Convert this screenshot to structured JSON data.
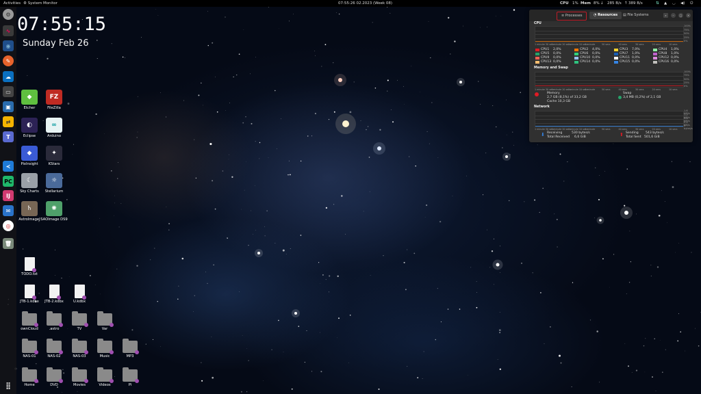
{
  "topbar": {
    "activities": "Activities",
    "app_name": "System Monitor",
    "datetime": "07:55:26 02.2023 (Week 08)",
    "cpu_label": "CPU",
    "cpu_val": "1%",
    "mem_label": "Mem",
    "mem_val": "8%",
    "net_down": "285 B/s",
    "net_up": "389 B/s"
  },
  "desktop": {
    "clock": "07:55:15",
    "date": "Sunday Feb 26"
  },
  "dock": {
    "items": [
      "settings-icon",
      "system-monitor-icon",
      "firefox-icon",
      "compass-icon",
      "nextcloud-icon",
      "terminal-icon",
      "virtualbox-icon",
      "remmina-icon",
      "thunderbird-icon",
      "vscode-icon",
      "pycharm-icon",
      "intellij-icon",
      "whatsapp-icon",
      "chrome-icon",
      "trash-icon",
      "app-grid-icon"
    ]
  },
  "icons": [
    {
      "label": "Etcher",
      "kind": "app",
      "color": "#5fbf3f",
      "glyph": "◆"
    },
    {
      "label": "FileZilla",
      "kind": "app",
      "color": "#bf2b23",
      "glyph": "FZ"
    },
    {
      "label": "Eclipse",
      "kind": "app",
      "color": "#2c2255",
      "glyph": "◐"
    },
    {
      "label": "Arduino",
      "kind": "app",
      "color": "#e8f4f4",
      "glyph": "∞"
    },
    {
      "label": "PixInsight",
      "kind": "app",
      "color": "#3a5bd6",
      "glyph": "◆"
    },
    {
      "label": "KStars",
      "kind": "app",
      "color": "#2a2a3a",
      "glyph": "✦"
    },
    {
      "label": "Sky Charts",
      "kind": "app",
      "color": "#9aa0a8",
      "glyph": "☾"
    },
    {
      "label": "Stellarium",
      "kind": "app",
      "color": "#4a6a9a",
      "glyph": "☼"
    },
    {
      "label": "AstroImageJ",
      "kind": "app",
      "color": "#776655",
      "glyph": "♄"
    },
    {
      "label": "SAOImage DS9",
      "kind": "app",
      "color": "#4fa06a",
      "glyph": "✺"
    },
    {
      "label": "TODO.txt",
      "kind": "file"
    },
    {
      "label": "JTB-1.kdbx",
      "kind": "file"
    },
    {
      "label": "JTB-2.kdbx",
      "kind": "file"
    },
    {
      "label": "U.kdbx",
      "kind": "file"
    },
    {
      "label": "ownCloud",
      "kind": "folder"
    },
    {
      "label": ".astro",
      "kind": "folder"
    },
    {
      "label": "TV",
      "kind": "folder"
    },
    {
      "label": "Var",
      "kind": "folder"
    },
    {
      "label": "NAS-01",
      "kind": "folder"
    },
    {
      "label": "NAS-02",
      "kind": "folder"
    },
    {
      "label": "NAS-03",
      "kind": "folder"
    },
    {
      "label": "Music",
      "kind": "folder"
    },
    {
      "label": "MP3",
      "kind": "folder"
    },
    {
      "label": "Home",
      "kind": "folder"
    },
    {
      "label": "DVD",
      "kind": "folder"
    },
    {
      "label": "Movies",
      "kind": "folder"
    },
    {
      "label": "Videos",
      "kind": "folder"
    },
    {
      "label": "Pi",
      "kind": "folder"
    }
  ],
  "monitor": {
    "tabs": [
      "Processes",
      "Resources",
      "File Systems"
    ],
    "active_tab": "Resources",
    "cpu_title": "CPU",
    "mem_title": "Memory and Swap",
    "net_title": "Network",
    "y_ticks": [
      "100%",
      "75%",
      "50%",
      "25%",
      "0%"
    ],
    "x_ticks": [
      "1 minute 30 secs",
      "1 minute 20 secs",
      "1 minute 10 secs",
      "1 minute",
      "50 secs",
      "40 secs",
      "30 secs",
      "20 secs",
      "10 secs"
    ],
    "net_y_ticks": [
      "1.6 KiB/s",
      "1.2 KiB/s",
      "0.8 KiB/s",
      "0.4 KiB/s",
      "0 bytes/s"
    ],
    "cpus": [
      {
        "name": "CPU1",
        "val": "2,0%",
        "color": "#e01b24"
      },
      {
        "name": "CPU2",
        "val": "4,0%",
        "color": "#ff7800"
      },
      {
        "name": "CPU3",
        "val": "7,0%",
        "color": "#f6d32d"
      },
      {
        "name": "CPU4",
        "val": "1,0%",
        "color": "#8ff0a4"
      },
      {
        "name": "CPU5",
        "val": "0,0%",
        "color": "#26a269"
      },
      {
        "name": "CPU6",
        "val": "0,0%",
        "color": "#33d17a"
      },
      {
        "name": "CPU7",
        "val": "1,0%",
        "color": "#1a5fb4"
      },
      {
        "name": "CPU8",
        "val": "1,0%",
        "color": "#c061cb"
      },
      {
        "name": "CPU9",
        "val": "0,0%",
        "color": "#f66151"
      },
      {
        "name": "CPU10",
        "val": "0,0%",
        "color": "#99c1f1"
      },
      {
        "name": "CPU11",
        "val": "0,0%",
        "color": "#ffffff"
      },
      {
        "name": "CPU12",
        "val": "0,0%",
        "color": "#dc8add"
      },
      {
        "name": "CPU13",
        "val": "0,0%",
        "color": "#ffbe6f"
      },
      {
        "name": "CPU14",
        "val": "0,0%",
        "color": "#2ec27e"
      },
      {
        "name": "CPU15",
        "val": "0,0%",
        "color": "#3584e4"
      },
      {
        "name": "CPU16",
        "val": "0,0%",
        "color": "#c0bfbc"
      }
    ],
    "memory": {
      "label": "Memory",
      "used": "2,7 GB (8,1%) of 33,2 GB",
      "cache": "Cache 10,3 GB",
      "color": "#e01b24"
    },
    "swap": {
      "label": "Swap",
      "used": "3,4 MB (0,2%) of 2,1 GB",
      "color": "#26a269"
    },
    "receiving": {
      "label": "Receiving",
      "rate": "530 bytes/s",
      "total_label": "Total Received",
      "total": "6,6 GiB",
      "color": "#3584e4"
    },
    "sending": {
      "label": "Sending",
      "rate": "543 bytes/s",
      "total_label": "Total Sent",
      "total": "501,6 GiB",
      "color": "#e01b24"
    }
  }
}
